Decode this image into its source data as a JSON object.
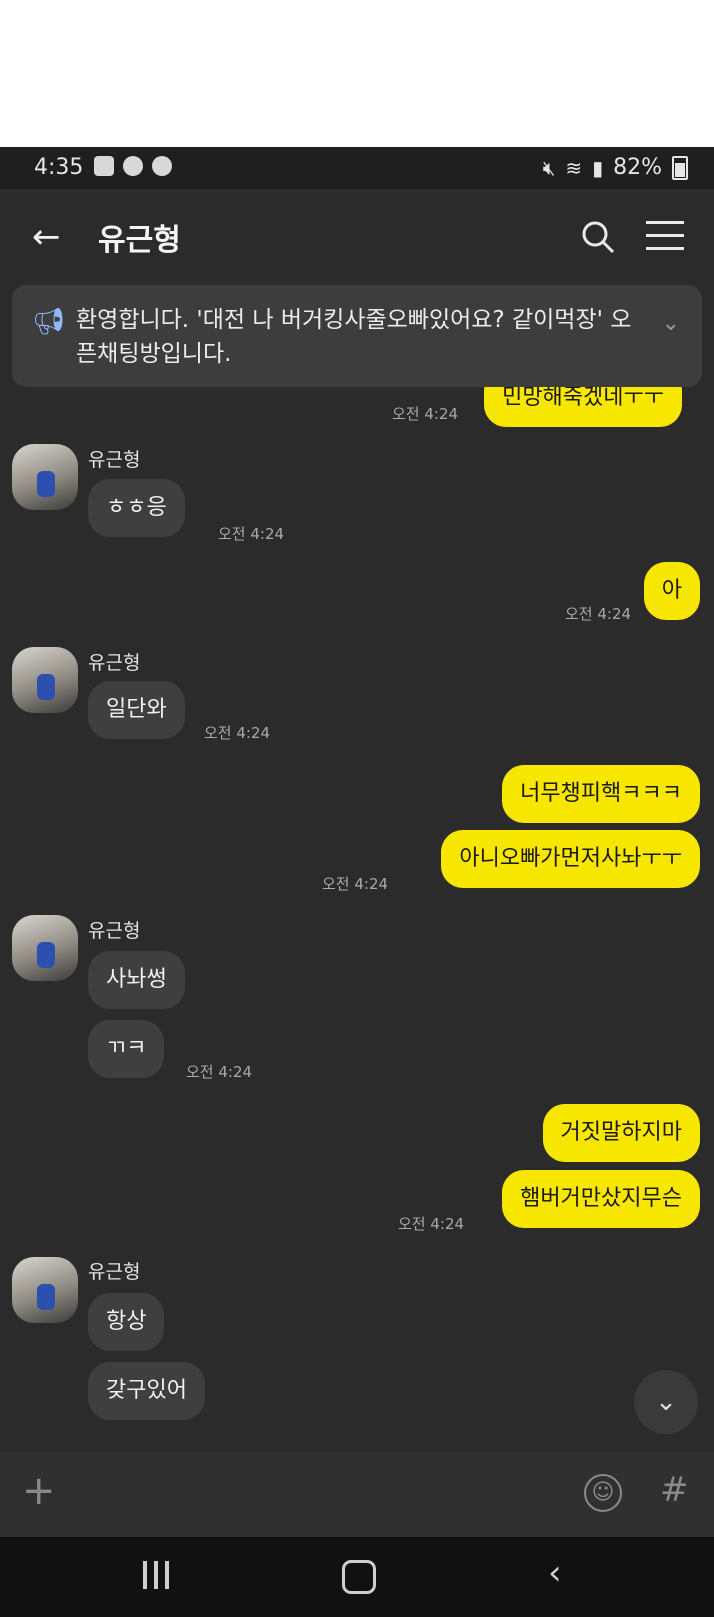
{
  "status_bar": {
    "time": "4:35",
    "battery": "82%"
  },
  "header": {
    "title": "유근형"
  },
  "notice": {
    "text": "환영합니다. '대전 나 버거킹사줄오빠있어요? 같이먹장' 오픈채팅방입니다."
  },
  "contact_name": "유근형",
  "messages": {
    "m1": {
      "text": "민망해죽겠네ㅜㅜ",
      "time": "오전 4:24"
    },
    "m2": {
      "sender": "유근형",
      "text": "ㅎㅎ응",
      "time": "오전 4:24"
    },
    "m3": {
      "text": "아",
      "time": "오전 4:24"
    },
    "m4": {
      "sender": "유근형",
      "text": "일단와",
      "time": "오전 4:24"
    },
    "m5": {
      "text": "너무챙피핵ㅋㅋㅋ"
    },
    "m6": {
      "text": "아니오빠가먼저사놔ㅜㅜ",
      "time": "오전 4:24"
    },
    "m7": {
      "sender": "유근형",
      "text": "사놔썽"
    },
    "m8": {
      "text": "ㄲㅋ",
      "time": "오전 4:24"
    },
    "m9": {
      "text": "거짓말하지마"
    },
    "m10": {
      "text": "햄버거만샀지무슨",
      "time": "오전 4:24"
    },
    "m11": {
      "sender": "유근형",
      "text": "항상"
    },
    "m12": {
      "text": "갖구있어"
    }
  },
  "colors": {
    "my_bubble": "#f7e600",
    "their_bubble": "#3f3f3f",
    "background": "#2b2b2b"
  }
}
